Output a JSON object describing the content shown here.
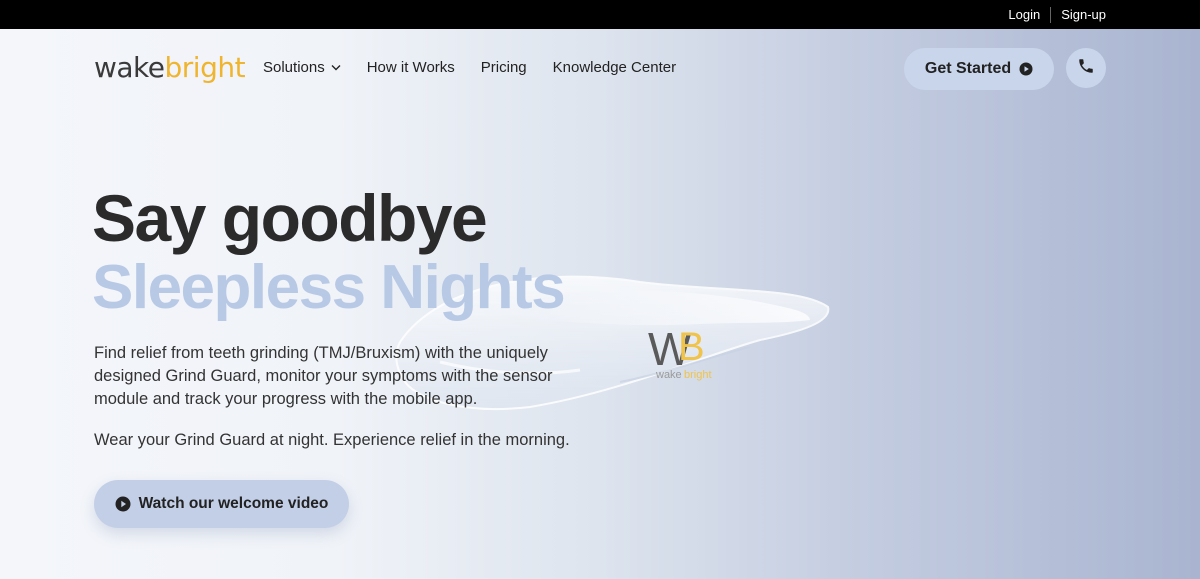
{
  "topbar": {
    "login": "Login",
    "signup": "Sign-up"
  },
  "logo": {
    "part1": "wake",
    "part2": "bright"
  },
  "nav": {
    "items": [
      {
        "label": "Solutions",
        "has_dropdown": true
      },
      {
        "label": "How it Works"
      },
      {
        "label": "Pricing"
      },
      {
        "label": "Knowledge Center"
      }
    ],
    "cta_label": "Get Started",
    "phone_icon": "phone-icon"
  },
  "hero": {
    "title": "Say goodbye",
    "subtitle": "Sleepless Nights",
    "description": "Find relief from teeth grinding (TMJ/Bruxism) with the uniquely designed Grind Guard, monitor your symptoms with the sensor module and track your progress with the mobile app.",
    "tagline": "Wear your Grind Guard at night. Experience relief in the morning.",
    "video_button": "Watch our welcome video"
  },
  "product_image": {
    "logo_letters_1": "W",
    "logo_letters_2": "B",
    "logo_word_1": "wake",
    "logo_word_2": "bright"
  },
  "colors": {
    "accent": "#f0b52e",
    "button_bg": "#c8d5ea",
    "subtitle": "#b8c9e6"
  }
}
